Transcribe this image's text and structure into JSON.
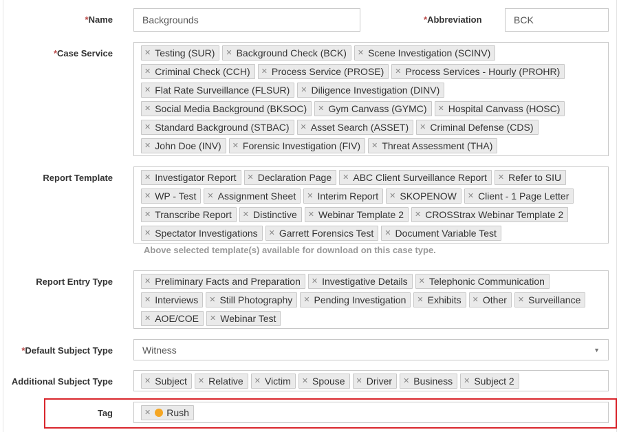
{
  "name": {
    "label": "Name",
    "value": "Backgrounds"
  },
  "abbreviation": {
    "label": "Abbreviation",
    "value": "BCK"
  },
  "case_service": {
    "label": "Case Service",
    "chips": [
      "Testing (SUR)",
      "Background Check (BCK)",
      "Scene Investigation (SCINV)",
      "Criminal Check (CCH)",
      "Process Service (PROSE)",
      "Process Services - Hourly (PROHR)",
      "Flat Rate Surveillance (FLSUR)",
      "Diligence Investigation (DINV)",
      "Social Media Background (BKSOC)",
      "Gym Canvass (GYMC)",
      "Hospital Canvass (HOSC)",
      "Standard Background (STBAC)",
      "Asset Search (ASSET)",
      "Criminal Defense (CDS)",
      "John Doe (INV)",
      "Forensic Investigation (FIV)",
      "Threat Assessment (THA)"
    ]
  },
  "report_template": {
    "label": "Report Template",
    "chips": [
      "Investigator Report",
      "Declaration Page",
      "ABC Client Surveillance Report",
      "Refer to SIU",
      "WP - Test",
      "Assignment Sheet",
      "Interim Report",
      "SKOPENOW",
      "Client - 1 Page Letter",
      "Transcribe Report",
      "Distinctive",
      "Webinar Template 2",
      "CROSStrax Webinar Template 2",
      "Spectator Investigations",
      "Garrett Forensics Test",
      "Document Variable Test"
    ],
    "hint": "Above selected template(s) available for download on this case type."
  },
  "report_entry_type": {
    "label": "Report Entry Type",
    "chips": [
      "Preliminary Facts and Preparation",
      "Investigative Details",
      "Telephonic Communication",
      "Interviews",
      "Still Photography",
      "Pending Investigation",
      "Exhibits",
      "Other",
      "Surveillance",
      "AOE/COE",
      "Webinar Test"
    ]
  },
  "default_subject_type": {
    "label": "Default Subject Type",
    "value": "Witness"
  },
  "additional_subject_type": {
    "label": "Additional Subject Type",
    "chips": [
      "Subject",
      "Relative",
      "Victim",
      "Spouse",
      "Driver",
      "Business",
      "Subject 2"
    ]
  },
  "tag": {
    "label": "Tag",
    "chips": [
      "Rush"
    ],
    "dot_color": "#f5a623"
  },
  "required_marker": "*",
  "remove_glyph": "✕",
  "colors": {
    "required": "#b94a48",
    "highlight_border": "#d9262c"
  }
}
